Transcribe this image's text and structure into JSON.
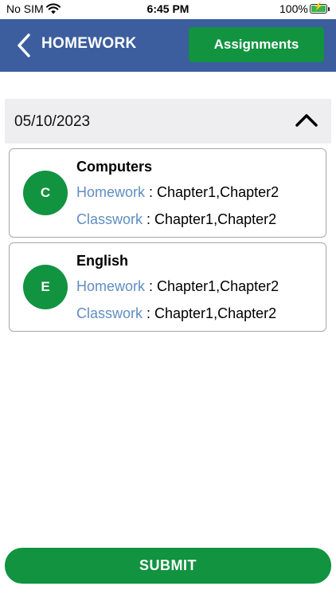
{
  "status_bar": {
    "carrier": "No SIM",
    "time": "6:45 PM",
    "battery": "100%"
  },
  "header": {
    "title": "HOMEWORK",
    "assignments_label": "Assignments",
    "back_icon": "chevron-left-icon",
    "background": "#3c5e9e"
  },
  "date_section": {
    "date": "05/10/2023",
    "toggle_icon": "chevron-up-icon"
  },
  "subjects": [
    {
      "initial": "C",
      "name": "Computers",
      "homework_label": "Homework",
      "homework_value": " : Chapter1,Chapter2",
      "classwork_label": "Classwork",
      "classwork_value": " : Chapter1,Chapter2"
    },
    {
      "initial": "E",
      "name": "English",
      "homework_label": "Homework",
      "homework_value": " : Chapter1,Chapter2",
      "classwork_label": "Classwork",
      "classwork_value": " : Chapter1,Chapter2"
    }
  ],
  "submit_label": "SUBMIT",
  "colors": {
    "accent_green": "#119340",
    "label_blue": "#5f8ec1"
  }
}
